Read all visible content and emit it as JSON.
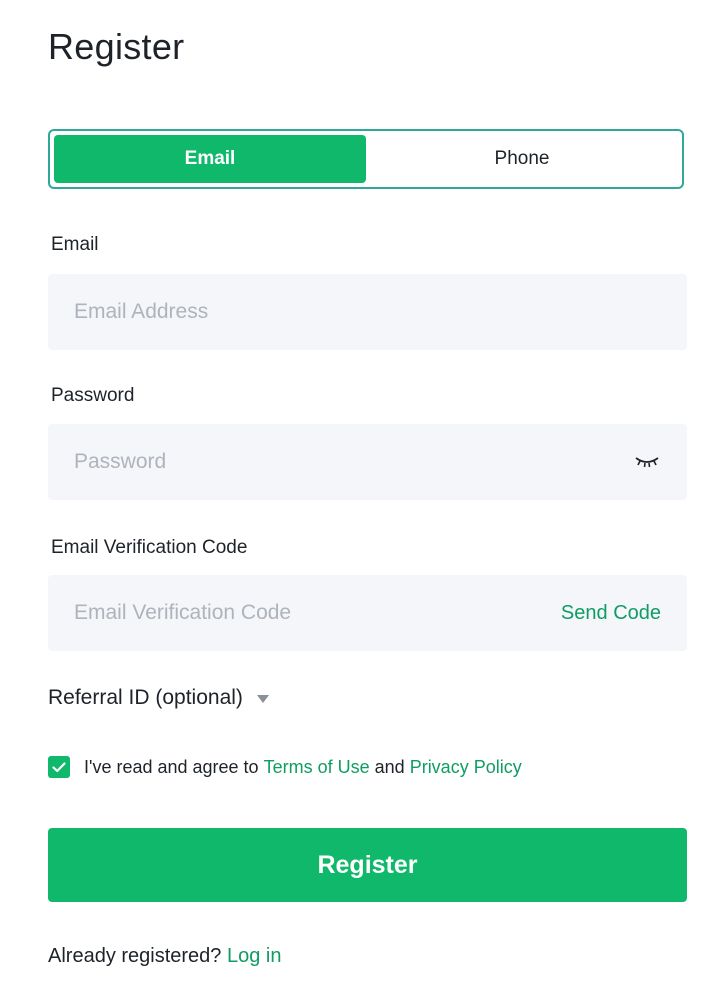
{
  "page": {
    "title": "Register"
  },
  "tabs": [
    {
      "label": "Email",
      "active": true
    },
    {
      "label": "Phone",
      "active": false
    }
  ],
  "email_field": {
    "label": "Email",
    "placeholder": "Email Address",
    "value": ""
  },
  "password_field": {
    "label": "Password",
    "placeholder": "Password",
    "value": "",
    "toggle_icon": "eye-closed-icon"
  },
  "verification_field": {
    "label": "Email Verification Code",
    "placeholder": "Email Verification Code",
    "value": "",
    "action": "Send Code"
  },
  "referral": {
    "label": "Referral ID (optional)",
    "icon": "caret-down-icon"
  },
  "agreement": {
    "checked": true,
    "prefix": "I've read and agree to",
    "terms_link": "Terms of Use",
    "conjunction": "and",
    "privacy_link": "Privacy Policy"
  },
  "register_button": {
    "label": "Register"
  },
  "login_prompt": {
    "text": "Already registered?",
    "link": "Log in"
  },
  "colors": {
    "accent": "#0fb86a",
    "link": "#0f9d64",
    "tab_border": "#2fa89a",
    "field_bg": "#f5f6f9"
  }
}
